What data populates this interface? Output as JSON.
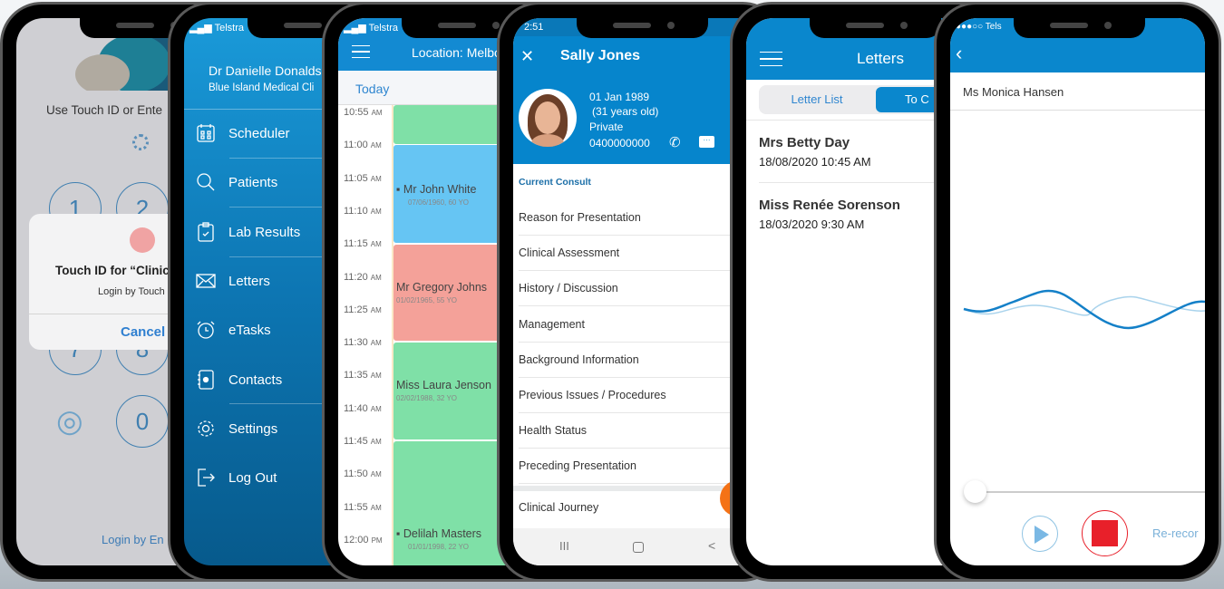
{
  "login": {
    "prompt": "Use Touch ID or Ente",
    "keys": [
      "1",
      "2",
      "7",
      "8",
      "0"
    ],
    "dialog": {
      "title": "Touch ID for “Clinic",
      "subtitle": "Login by Touch",
      "cancel": "Cancel"
    },
    "login_by_email": "Login by En"
  },
  "menu": {
    "carrier": "Telstra",
    "doctor": "Dr Danielle Donaldso",
    "clinic": "Blue Island Medical Cli",
    "items": [
      {
        "label": "Scheduler",
        "icon": "calendar-icon"
      },
      {
        "label": "Patients",
        "icon": "search-icon"
      },
      {
        "label": "Lab Results",
        "icon": "clipboard-check-icon"
      },
      {
        "label": "Letters",
        "icon": "envelope-icon"
      },
      {
        "label": "eTasks",
        "icon": "alarm-clock-icon"
      },
      {
        "label": "Contacts",
        "icon": "contact-book-icon"
      },
      {
        "label": "Settings",
        "icon": "gear-icon"
      },
      {
        "label": "Log Out",
        "icon": "logout-icon"
      }
    ]
  },
  "scheduler": {
    "carrier": "Telstra",
    "title": "Location: Melbo",
    "today": "Today",
    "times": [
      {
        "t": "10:55",
        "p": "AM"
      },
      {
        "t": "11:00",
        "p": "AM"
      },
      {
        "t": "11:05",
        "p": "AM"
      },
      {
        "t": "11:10",
        "p": "AM"
      },
      {
        "t": "11:15",
        "p": "AM"
      },
      {
        "t": "11:20",
        "p": "AM"
      },
      {
        "t": "11:25",
        "p": "AM"
      },
      {
        "t": "11:30",
        "p": "AM"
      },
      {
        "t": "11:35",
        "p": "AM"
      },
      {
        "t": "11:40",
        "p": "AM"
      },
      {
        "t": "11:45",
        "p": "AM"
      },
      {
        "t": "11:50",
        "p": "AM"
      },
      {
        "t": "11:55",
        "p": "AM"
      },
      {
        "t": "12:00",
        "p": "PM"
      }
    ],
    "appointments": [
      {
        "name": "",
        "dob": ""
      },
      {
        "name": "Mr John White",
        "dob": "07/06/1960, 60 YO"
      },
      {
        "name": "Mr Gregory Johns",
        "dob": "01/02/1965, 55 YO"
      },
      {
        "name": "Miss Laura Jenson",
        "dob": "02/02/1988, 32 YO"
      },
      {
        "name": "Delilah Masters",
        "dob": "01/01/1998, 22 YO"
      }
    ],
    "colors": {
      "green": "#7fe0a7",
      "blue": "#66c5f3",
      "salmon": "#f4a199"
    }
  },
  "patient": {
    "time": "2:51",
    "name": "Sally Jones",
    "dob": "01 Jan 1989",
    "age": "(31 years old)",
    "billing": "Private",
    "phone": "0400000000",
    "section": "Current Consult",
    "items": [
      "Reason for Presentation",
      "Clinical Assessment",
      "History / Discussion",
      "Management",
      "Background Information",
      "Previous Issues / Procedures",
      "Health Status",
      "Preceding Presentation"
    ],
    "journey": "Clinical Journey",
    "nav": {
      "recents": "III",
      "home": "O",
      "back": "<"
    }
  },
  "letters": {
    "title": "Letters",
    "tabs": [
      "Letter List",
      "To C"
    ],
    "list": [
      {
        "name": "Mrs Betty Day",
        "date": "18/08/2020 10:45 AM"
      },
      {
        "name": "Miss Renée Sorenson",
        "date": "18/03/2020 9:30 AM"
      }
    ]
  },
  "recorder": {
    "carrier": "●●●○○ Tels",
    "patient": "Ms Monica Hansen",
    "progress": 0,
    "rerecord": "Re-recor"
  },
  "colors": {
    "primary": "#0a87cd",
    "record": "#e8202a",
    "fab": "#f47216"
  }
}
